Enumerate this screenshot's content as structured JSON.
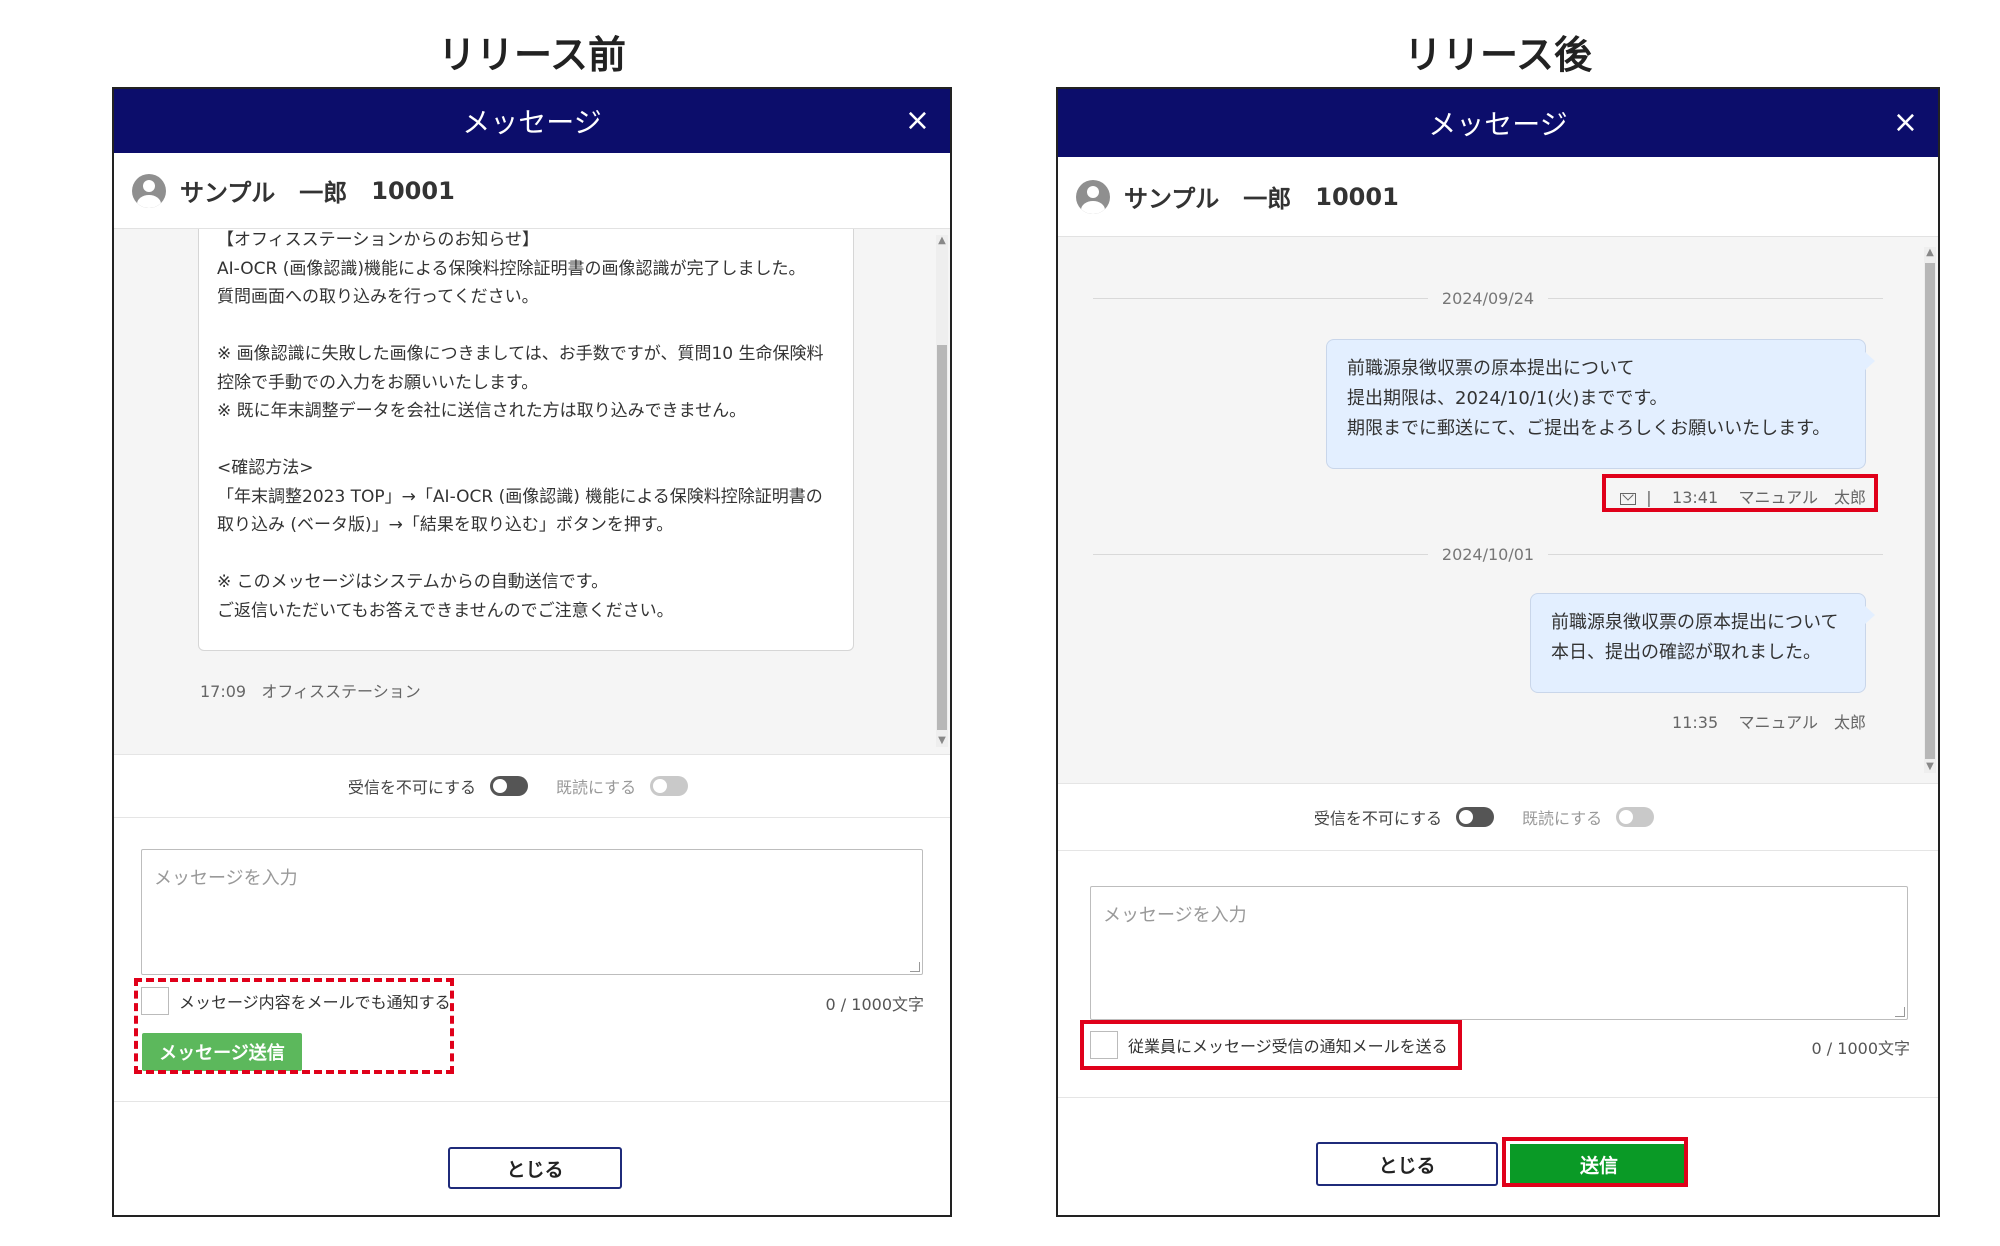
{
  "before": {
    "heading": "リリース前",
    "dialog_title": "メッセージ",
    "close": "×",
    "user": {
      "name": "サンプル　一郎",
      "id": "10001"
    },
    "message": {
      "text": "【オフィスステーションからのお知らせ】\nAI-OCR (画像認識)機能による保険料控除証明書の画像認識が完了しました。\n質問画面への取り込みを行ってください。\n\n※ 画像認識に失敗した画像につきましては、お手数ですが、質問10 生命保険料控除で手動での入力をお願いいたします。\n※ 既に年末調整データを会社に送信された方は取り込みできません。\n\n<確認方法>\n「年末調整2023 TOP」→「AI-OCR (画像認識) 機能による保険料控除証明書の取り込み (ベータ版)」→「結果を取り込む」ボタンを押す。\n\n※ このメッセージはシステムからの自動送信です。\nご返信いただいてもお答えできませんのでご注意ください。",
      "time": "17:09",
      "sender": "オフィスステーション"
    },
    "toggle_reject": "受信を不可にする",
    "toggle_read": "既読にする",
    "placeholder": "メッセージを入力",
    "checkbox_label": "メッセージ内容をメールでも通知する",
    "counter": "0 / 1000文字",
    "send_button": "メッセージ送信",
    "close_button": "とじる"
  },
  "after": {
    "heading": "リリース後",
    "dialog_title": "メッセージ",
    "close": "×",
    "user": {
      "name": "サンプル　一郎",
      "id": "10001"
    },
    "messages": [
      {
        "date": "2024/09/24",
        "text": "前職源泉徴収票の原本提出について\n提出期限は、2024/10/1(火)までです。\n期限までに郵送にて、ご提出をよろしくお願いいたします。",
        "separator": "|",
        "time": "13:41",
        "sender": "マニュアル　太郎"
      },
      {
        "date": "2024/10/01",
        "text": "前職源泉徴収票の原本提出について\n本日、提出の確認が取れました。",
        "time": "11:35",
        "sender": "マニュアル　太郎"
      }
    ],
    "toggle_reject": "受信を不可にする",
    "toggle_read": "既読にする",
    "placeholder": "メッセージを入力",
    "checkbox_label": "従業員にメッセージ受信の通知メールを送る",
    "counter": "0 / 1000文字",
    "close_button": "とじる",
    "send_button": "送信"
  },
  "colors": {
    "header_navy": "#0c0d6b",
    "highlight_red": "#e0001a",
    "send_green": "#0a9a26",
    "old_send_green": "#5cb85c",
    "bubble_blue": "#e3efff"
  },
  "icons": [
    "close-icon",
    "avatar-icon",
    "mail-icon"
  ]
}
